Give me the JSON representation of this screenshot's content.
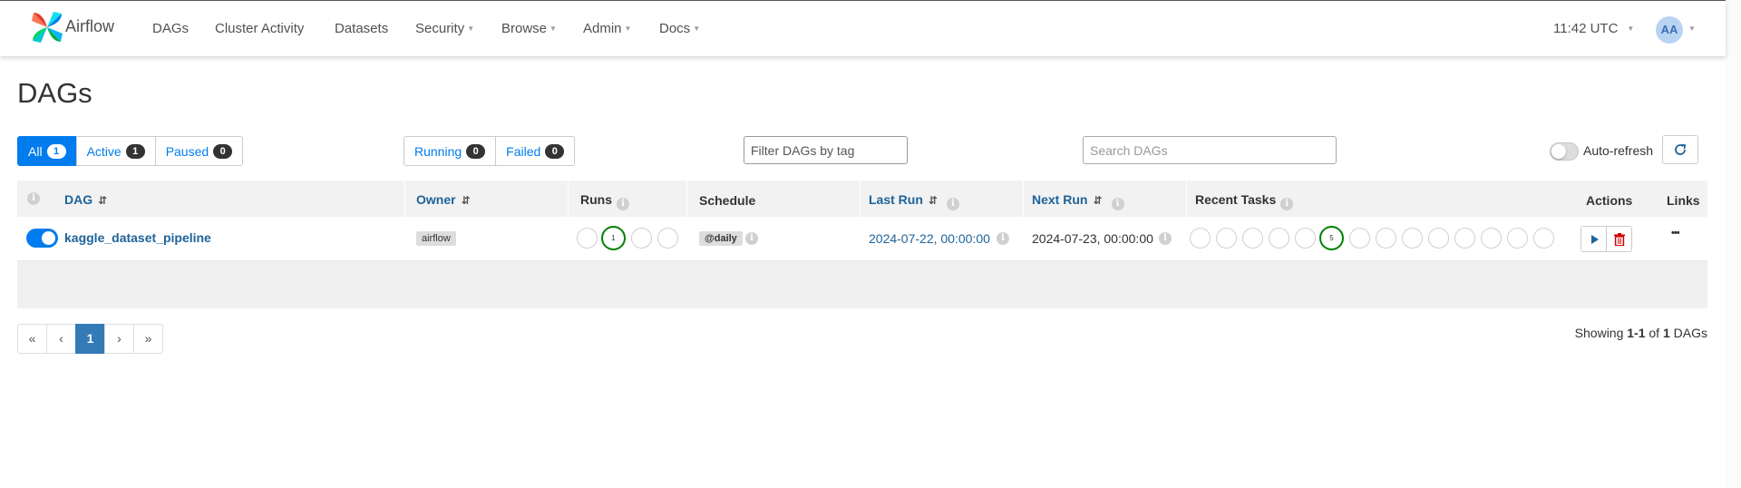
{
  "nav": {
    "brand": "Airflow",
    "items": [
      {
        "label": "DAGs",
        "dropdown": false
      },
      {
        "label": "Cluster Activity",
        "dropdown": false
      },
      {
        "label": "Datasets",
        "dropdown": false
      },
      {
        "label": "Security",
        "dropdown": true
      },
      {
        "label": "Browse",
        "dropdown": true
      },
      {
        "label": "Admin",
        "dropdown": true
      },
      {
        "label": "Docs",
        "dropdown": true
      }
    ],
    "clock": "11:42 UTC",
    "avatar": "AA"
  },
  "page_title": "DAGs",
  "status_filters": [
    {
      "label": "All",
      "count": "1",
      "active": true
    },
    {
      "label": "Active",
      "count": "1",
      "active": false
    },
    {
      "label": "Paused",
      "count": "0",
      "active": false
    }
  ],
  "run_filters": [
    {
      "label": "Running",
      "count": "0"
    },
    {
      "label": "Failed",
      "count": "0"
    }
  ],
  "tag_filter_placeholder": "Filter DAGs by tag",
  "search_placeholder": "Search DAGs",
  "auto_refresh_label": "Auto-refresh",
  "auto_refresh_on": false,
  "table": {
    "headers": {
      "dag": "DAG",
      "owner": "Owner",
      "runs": "Runs",
      "schedule": "Schedule",
      "last_run": "Last Run",
      "next_run": "Next Run",
      "recent_tasks": "Recent Tasks",
      "actions": "Actions",
      "links": "Links"
    },
    "rows": [
      {
        "dag_id": "kaggle_dataset_pipeline",
        "enabled": true,
        "owner": "airflow",
        "runs": [
          "",
          "1",
          "",
          ""
        ],
        "runs_success_index": 1,
        "schedule": "@daily",
        "last_run": "2024-07-22, 00:00:00",
        "next_run": "2024-07-23, 00:00:00",
        "recent_tasks": [
          "",
          "",
          "",
          "",
          "",
          "5",
          "",
          "",
          "",
          "",
          "",
          "",
          "",
          ""
        ],
        "recent_tasks_success_index": 5,
        "links_label": "•••"
      }
    ]
  },
  "pagination": {
    "first": "«",
    "prev": "‹",
    "current": "1",
    "next": "›",
    "last": "»"
  },
  "showing": {
    "prefix": "Showing ",
    "range": "1-1",
    "of": " of ",
    "total": "1",
    "suffix": " DAGs"
  },
  "colors": {
    "primary": "#017cee",
    "link": "#1e6399",
    "success": "#008000",
    "delete": "#cc0000"
  },
  "icons": {
    "refresh": "refresh-icon",
    "trigger": "play-icon",
    "delete": "trash-icon",
    "more": "ellipsis-icon"
  }
}
